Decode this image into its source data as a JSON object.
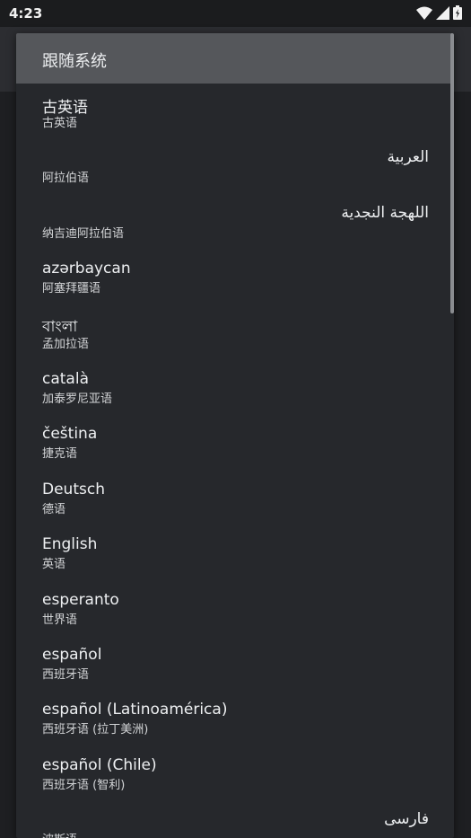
{
  "status_bar": {
    "time": "4:23"
  },
  "dialog": {
    "selected": {
      "label": "跟随系统"
    },
    "items": [
      {
        "native": "古英语",
        "sub": "古英语",
        "rtl": false
      },
      {
        "native": "العربية",
        "sub": "阿拉伯语",
        "rtl": true
      },
      {
        "native": "اللهجة النجدية",
        "sub": "纳吉迪阿拉伯语",
        "rtl": true
      },
      {
        "native": "azərbaycan",
        "sub": "阿塞拜疆语",
        "rtl": false
      },
      {
        "native": "বাংলা",
        "sub": "孟加拉语",
        "rtl": false
      },
      {
        "native": "català",
        "sub": "加泰罗尼亚语",
        "rtl": false
      },
      {
        "native": "čeština",
        "sub": "捷克语",
        "rtl": false
      },
      {
        "native": "Deutsch",
        "sub": "德语",
        "rtl": false
      },
      {
        "native": "English",
        "sub": "英语",
        "rtl": false
      },
      {
        "native": "esperanto",
        "sub": "世界语",
        "rtl": false
      },
      {
        "native": "español",
        "sub": "西班牙语",
        "rtl": false
      },
      {
        "native": "español (Latinoamérica)",
        "sub": "西班牙语 (拉丁美洲)",
        "rtl": false
      },
      {
        "native": "español (Chile)",
        "sub": "西班牙语 (智利)",
        "rtl": false
      },
      {
        "native": "فارسی",
        "sub": "波斯语",
        "rtl": true
      }
    ]
  }
}
